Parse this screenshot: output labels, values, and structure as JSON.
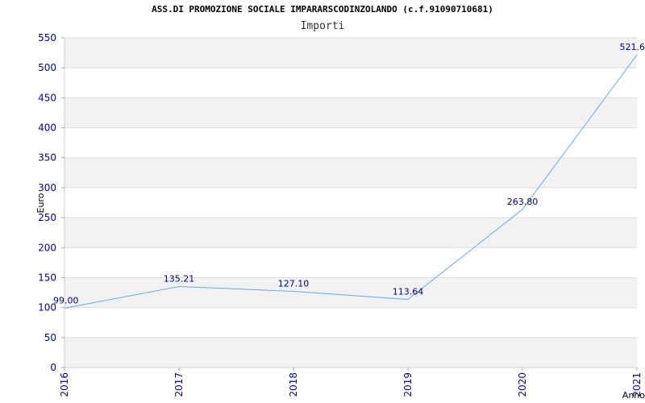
{
  "chart_data": {
    "type": "line",
    "title": "ASS.DI PROMOZIONE SOCIALE IMPARARSCODINZOLANDO (c.f.91090710681)",
    "subtitle": "Importi",
    "xlabel": "Anno",
    "ylabel": "Euro",
    "categories": [
      "2016",
      "2017",
      "2018",
      "2019",
      "2020",
      "2021"
    ],
    "values": [
      99.0,
      135.21,
      127.1,
      113.64,
      263.8,
      521.6
    ],
    "data_labels": [
      "99.00",
      "135.21",
      "127.10",
      "113.64",
      "263.80",
      "521.6"
    ],
    "ylim": [
      0,
      550
    ],
    "yticks": [
      0,
      50,
      100,
      150,
      200,
      250,
      300,
      350,
      400,
      450,
      500,
      550
    ],
    "grid": "horizontal bands",
    "colors": {
      "line": "#66aaee",
      "axis_text": "#0000aa",
      "label_text": "#000080",
      "band": "#f2f2f2",
      "grid": "#dddddd"
    }
  }
}
